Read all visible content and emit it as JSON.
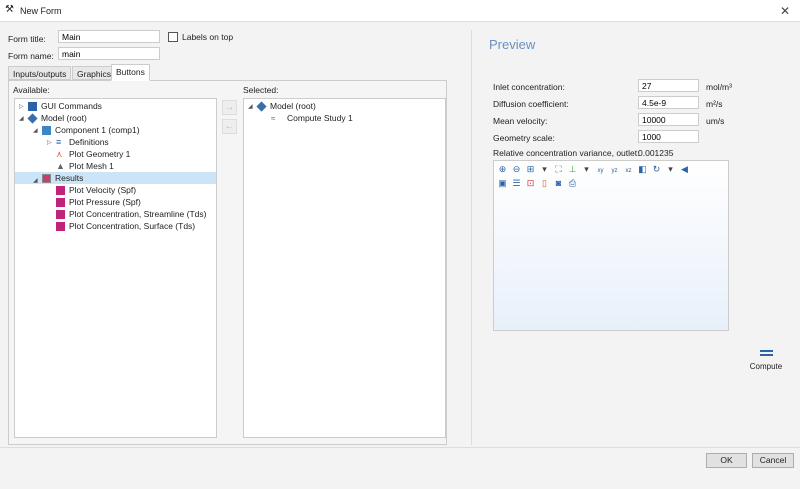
{
  "window": {
    "title": "New Form",
    "close": "✕"
  },
  "form": {
    "title_label": "Form title:",
    "title_value": "Main",
    "name_label": "Form name:",
    "name_value": "main",
    "labels_on_top": "Labels on top",
    "labels_on_top_checked": false
  },
  "tabs": [
    {
      "label": "Inputs/outputs"
    },
    {
      "label": "Graphics"
    },
    {
      "label": "Buttons",
      "active": true
    }
  ],
  "available": {
    "label": "Available:",
    "items": [
      {
        "label": "GUI Commands"
      },
      {
        "label": "Model (root)"
      },
      {
        "label": "Component 1 (comp1)"
      },
      {
        "label": "Definitions"
      },
      {
        "label": "Plot Geometry 1"
      },
      {
        "label": "Plot Mesh 1"
      },
      {
        "label": "Results",
        "selected": true
      },
      {
        "label": "Plot Velocity (Spf)"
      },
      {
        "label": "Plot Pressure (Spf)"
      },
      {
        "label": "Plot Concentration, Streamline (Tds)"
      },
      {
        "label": "Plot Concentration, Surface (Tds)"
      }
    ]
  },
  "selected": {
    "label": "Selected:",
    "items": [
      {
        "label": "Model (root)"
      },
      {
        "label": "Compute Study 1"
      }
    ]
  },
  "preview": {
    "title": "Preview",
    "fields": [
      {
        "label": "Inlet concentration:",
        "value": "27",
        "unit": "mol/m³"
      },
      {
        "label": "Diffusion coefficient:",
        "value": "4.5e-9",
        "unit": "m²/s"
      },
      {
        "label": "Mean velocity:",
        "value": "10000",
        "unit": "um/s"
      },
      {
        "label": "Geometry scale:",
        "value": "1000",
        "unit": ""
      }
    ],
    "variance_label": "Relative concentration variance, outlet:",
    "variance_value": "0.001235",
    "compute_label": "Compute"
  },
  "buttons": {
    "ok": "OK",
    "cancel": "Cancel"
  },
  "colors": {
    "accent": "#2b62a8",
    "selection": "#cce4f7",
    "plot": "#e01f7a"
  }
}
